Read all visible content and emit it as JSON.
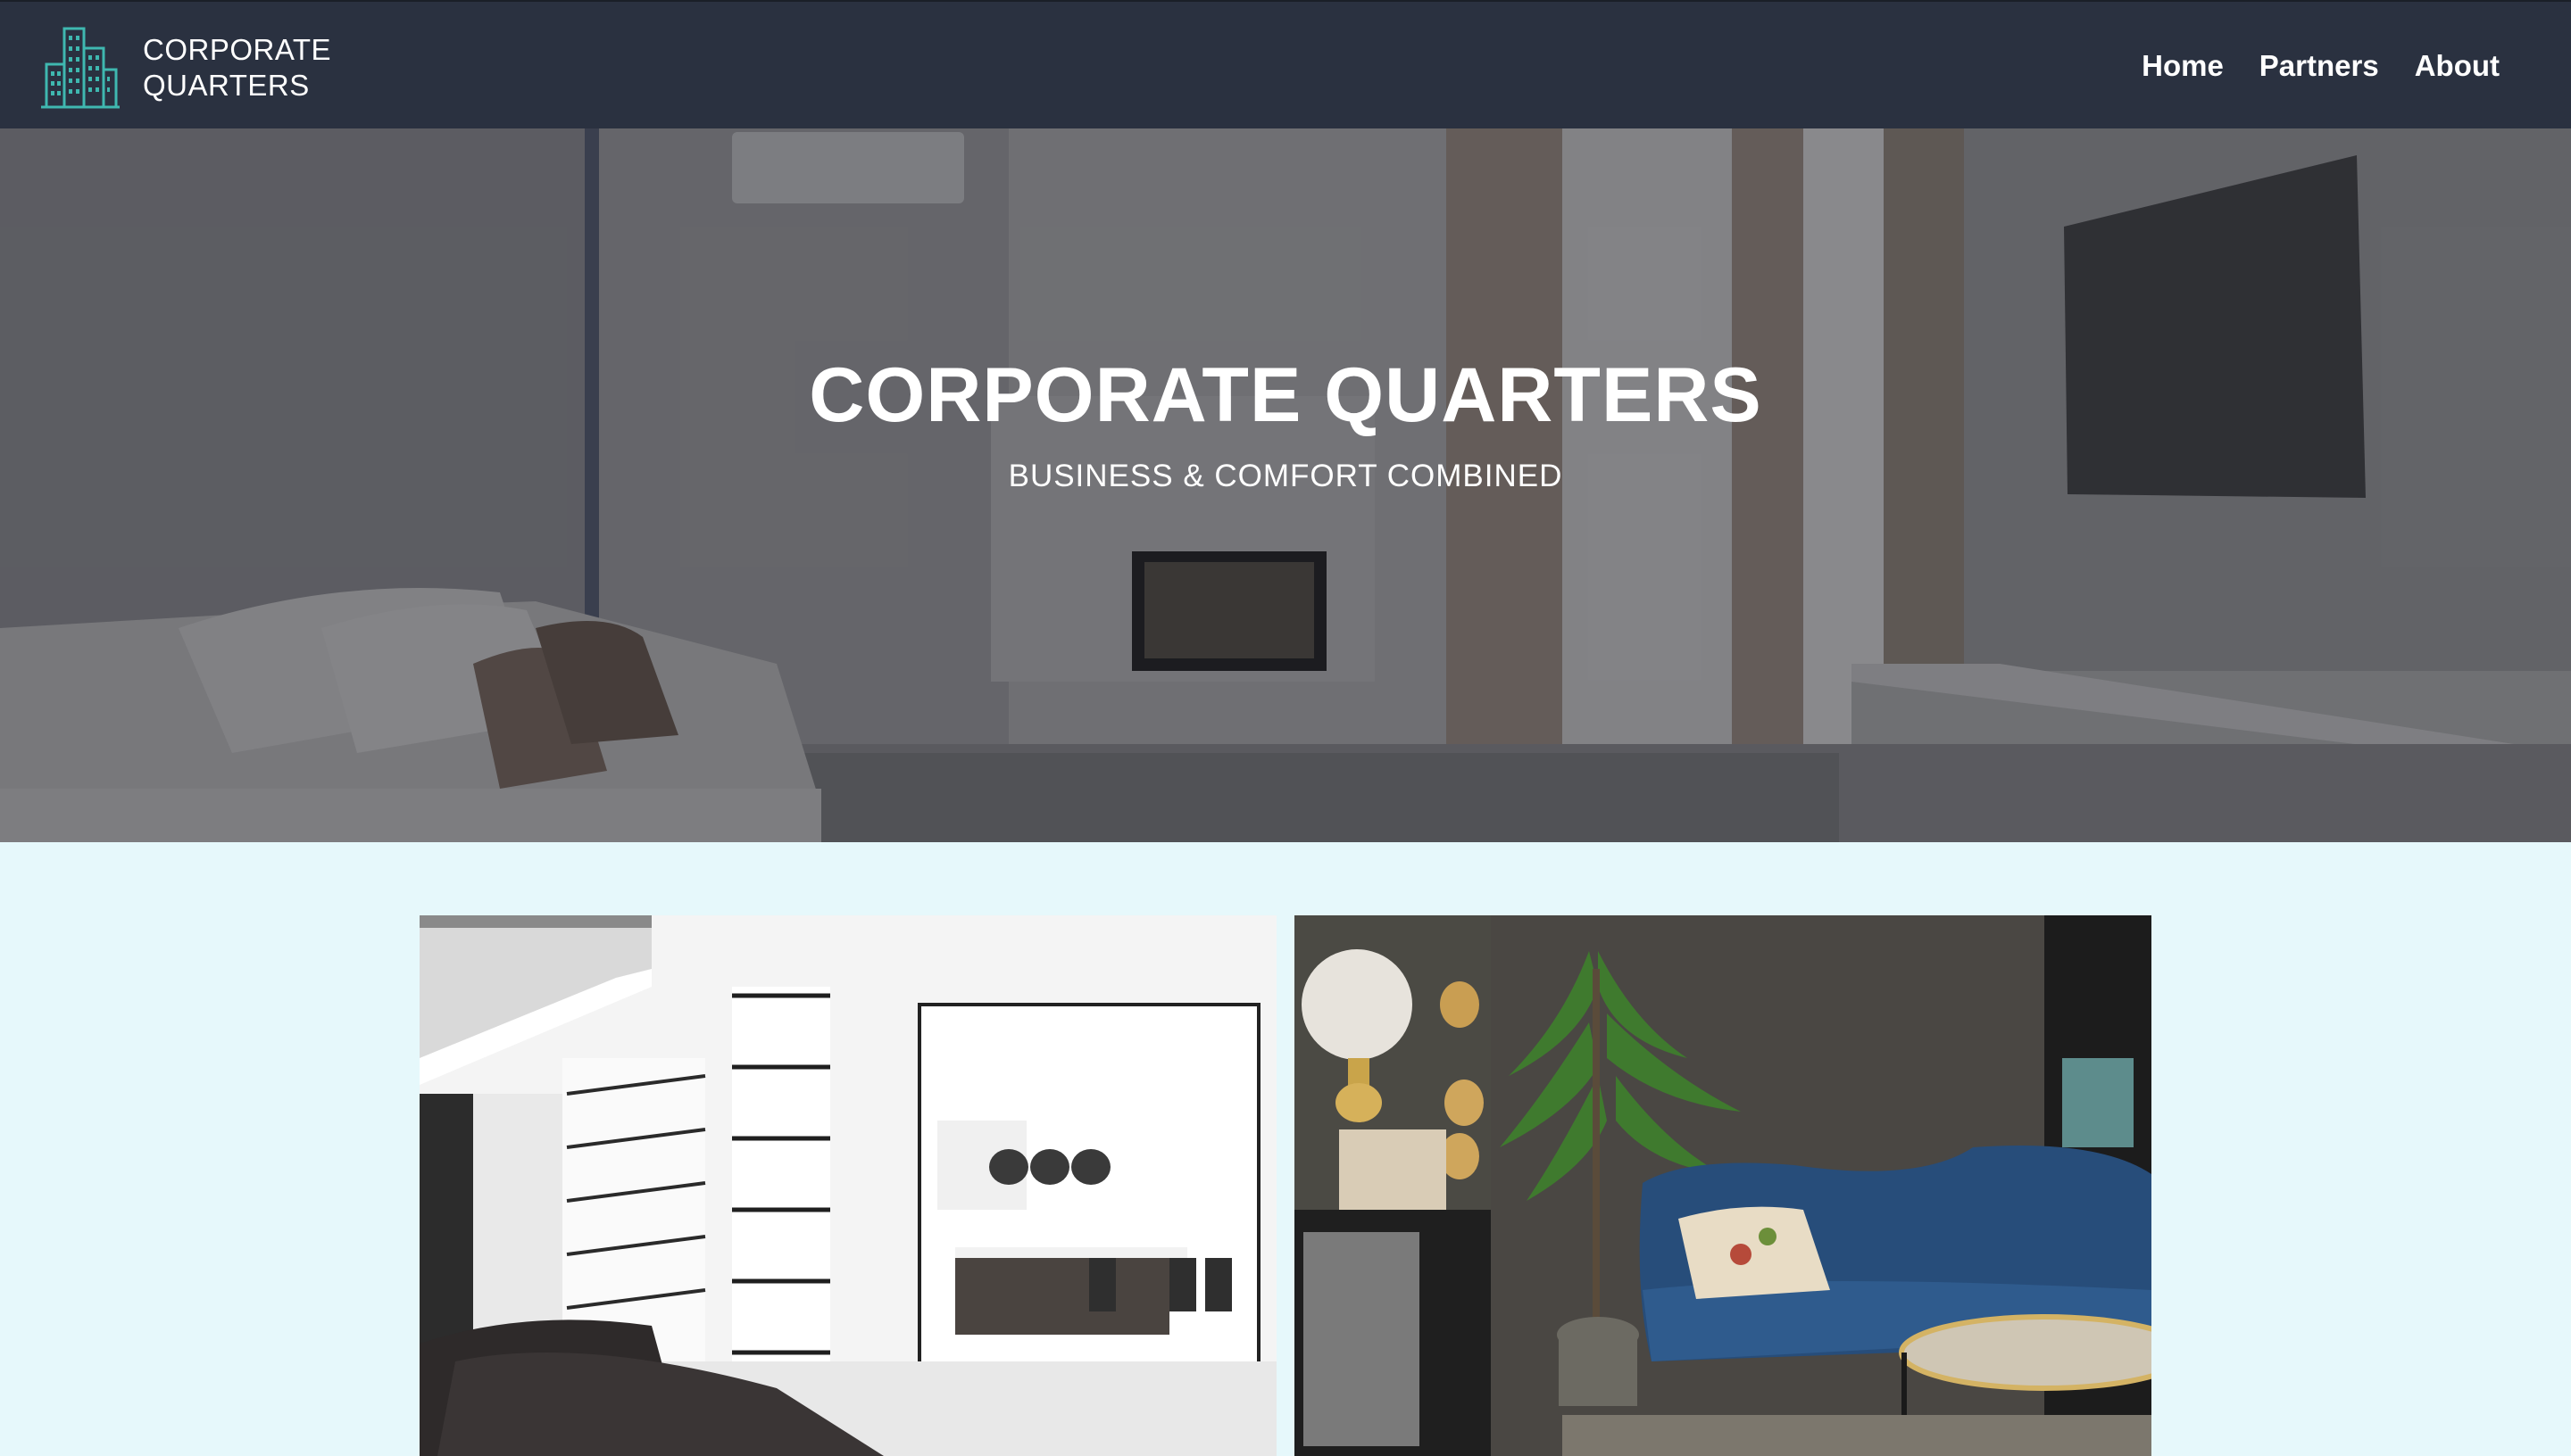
{
  "navbar": {
    "brand": {
      "line1": "CORPORATE",
      "line2": "QUARTERS",
      "logo_icon": "buildings-icon"
    },
    "links": [
      {
        "label": "Home"
      },
      {
        "label": "Partners"
      },
      {
        "label": "About"
      }
    ]
  },
  "hero": {
    "title": "CORPORATE QUARTERS",
    "subtitle": "BUSINESS & COMFORT COMBINED"
  },
  "colors": {
    "navbar_bg": "#2a3140",
    "page_bg": "#e6f8fb",
    "logo_accent": "#3fb8b0"
  }
}
